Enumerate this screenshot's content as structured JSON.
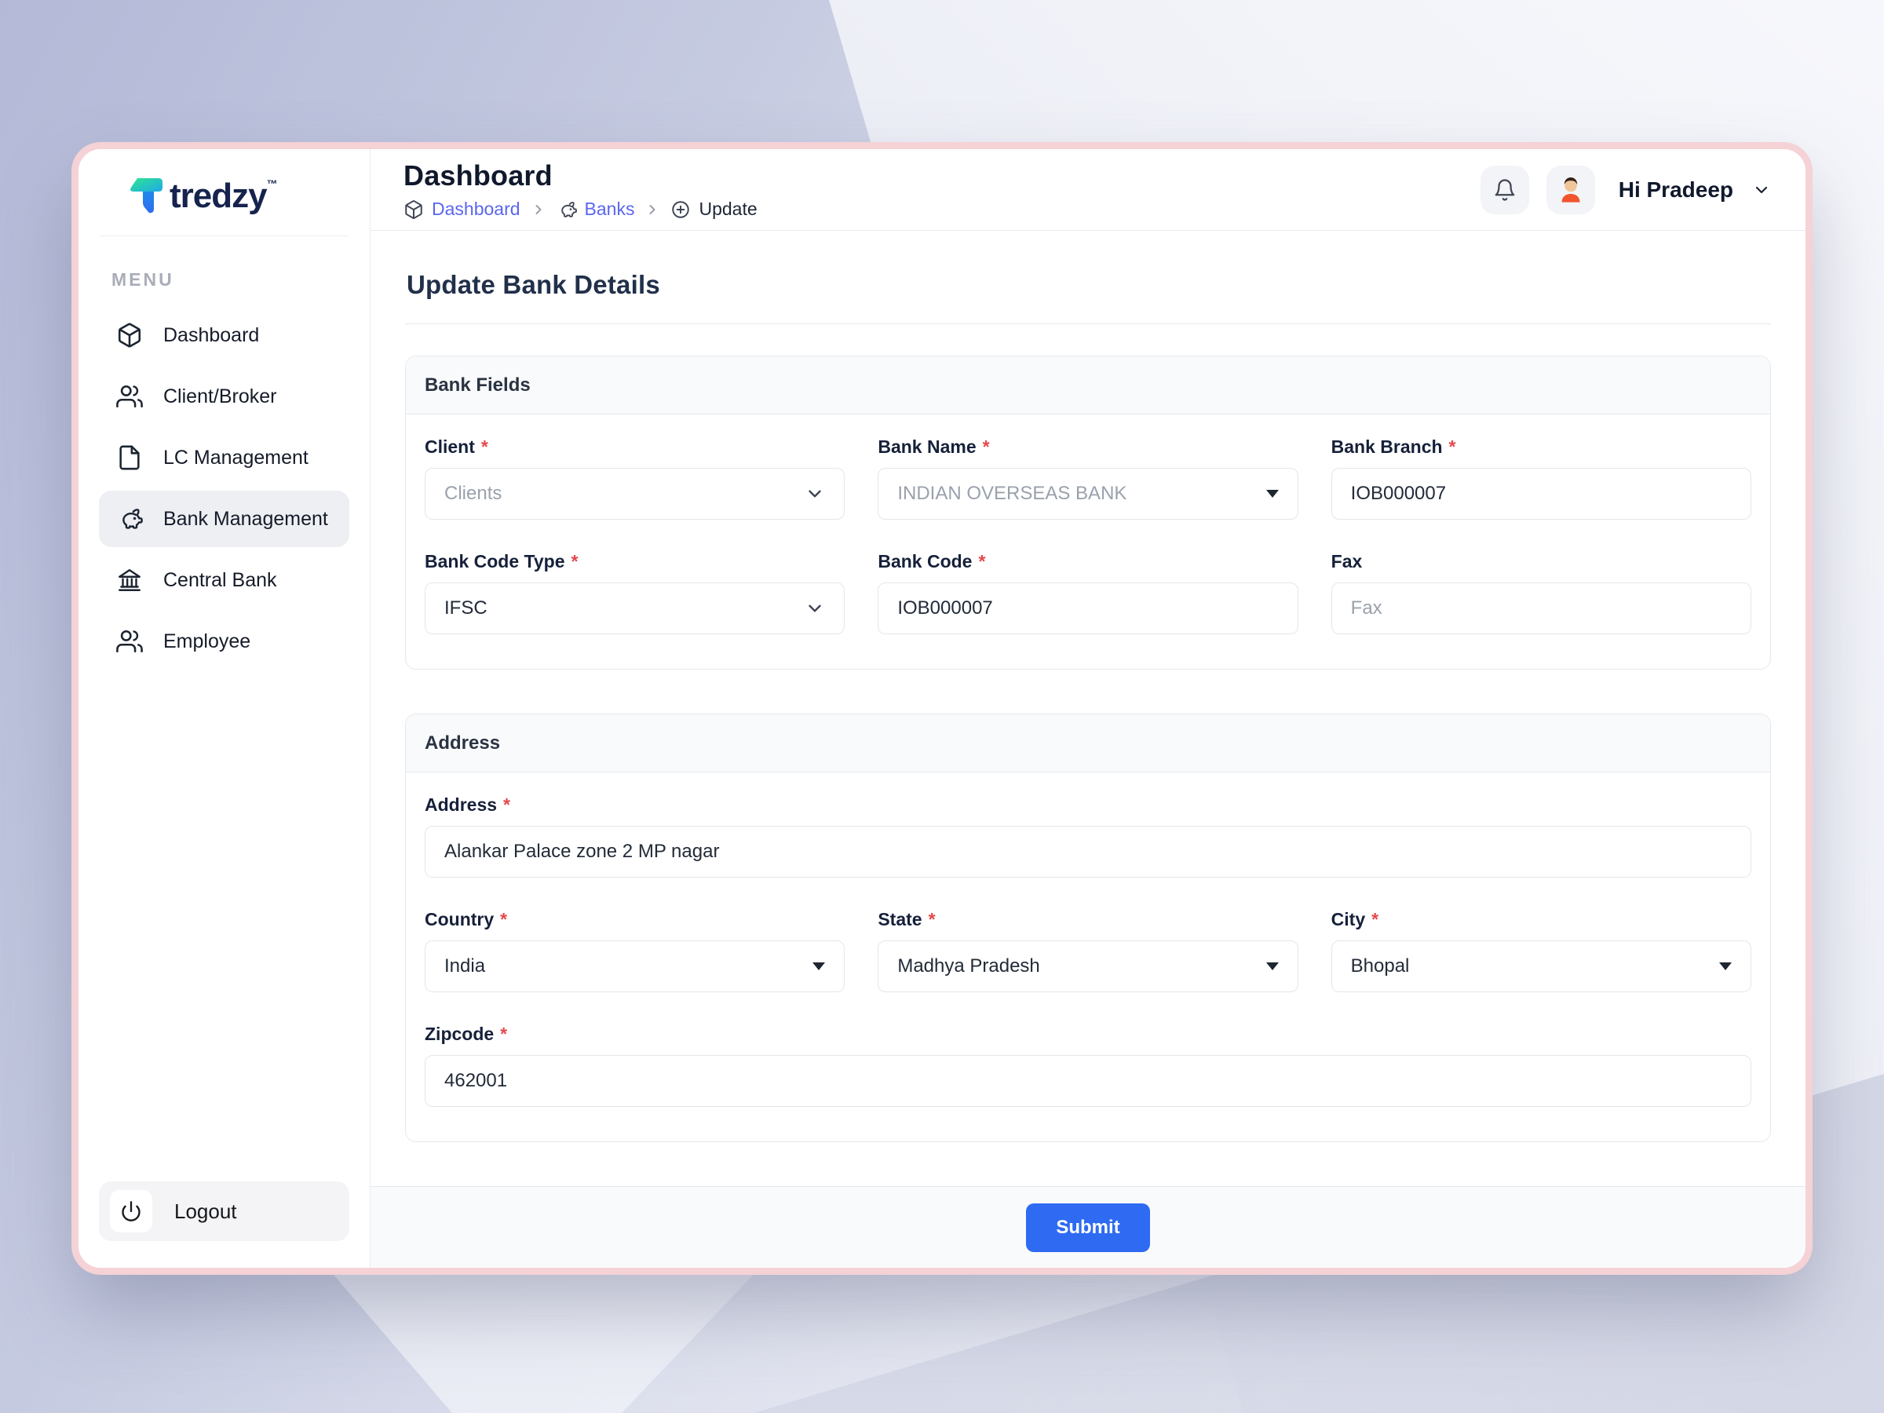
{
  "brand": {
    "name": "tredzy",
    "tm": "™"
  },
  "sidebar": {
    "menu_label": "MENU",
    "items": [
      {
        "label": "Dashboard",
        "icon": "cube-icon",
        "active": false
      },
      {
        "label": "Client/Broker",
        "icon": "users-icon",
        "active": false
      },
      {
        "label": "LC Management",
        "icon": "file-icon",
        "active": false
      },
      {
        "label": "Bank Management",
        "icon": "piggy-bank-icon",
        "active": true
      },
      {
        "label": "Central Bank",
        "icon": "bank-icon",
        "active": false
      },
      {
        "label": "Employee",
        "icon": "users-icon",
        "active": false
      }
    ],
    "logout_label": "Logout"
  },
  "header": {
    "title": "Dashboard",
    "breadcrumb": [
      {
        "label": "Dashboard",
        "icon": "cube-icon",
        "link": true
      },
      {
        "label": "Banks",
        "icon": "piggy-bank-icon",
        "link": true
      },
      {
        "label": "Update",
        "icon": "plus-circle-icon",
        "link": false
      }
    ],
    "greeting": "Hi Pradeep"
  },
  "page": {
    "title": "Update Bank Details"
  },
  "form": {
    "required_marker": "*",
    "sections": {
      "bank": "Bank Fields",
      "address": "Address"
    },
    "fields": {
      "client": {
        "label": "Client",
        "placeholder": "Clients",
        "required": true
      },
      "bank_name": {
        "label": "Bank Name",
        "value": "INDIAN OVERSEAS BANK",
        "required": true
      },
      "bank_branch": {
        "label": "Bank Branch",
        "value": "IOB000007",
        "required": true
      },
      "bank_code_type": {
        "label": "Bank Code Type",
        "value": "IFSC",
        "required": true
      },
      "bank_code": {
        "label": "Bank Code",
        "value": "IOB000007",
        "required": true
      },
      "fax": {
        "label": "Fax",
        "placeholder": "Fax",
        "required": false
      },
      "address": {
        "label": "Address",
        "value": "Alankar Palace zone 2 MP nagar",
        "required": true
      },
      "country": {
        "label": "Country",
        "value": "India",
        "required": true
      },
      "state": {
        "label": "State",
        "value": "Madhya Pradesh",
        "required": true
      },
      "city": {
        "label": "City",
        "value": "Bhopal",
        "required": true
      },
      "zipcode": {
        "label": "Zipcode",
        "value": "462001",
        "required": true
      }
    },
    "submit_label": "Submit"
  },
  "colors": {
    "accent_blue": "#2e6bf2",
    "link_indigo": "#5b66f0",
    "required_red": "#e5484d",
    "window_ring_pink": "#f5d2d6",
    "active_item_bg": "#edeff3",
    "section_header_bg": "#f9fafb",
    "background_lavender": "#b3b9d7"
  }
}
